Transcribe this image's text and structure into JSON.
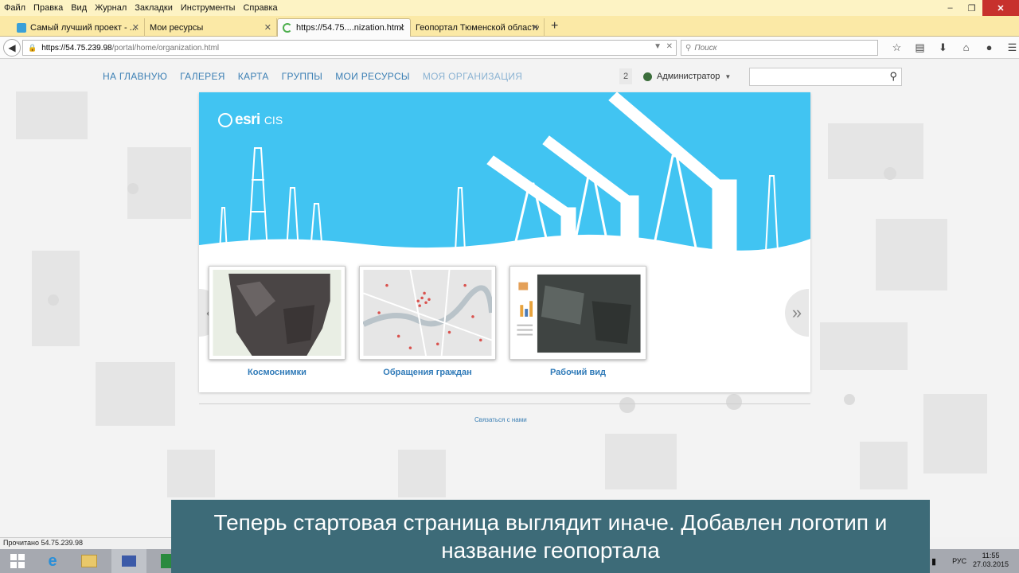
{
  "menubar": {
    "items": [
      "Файл",
      "Правка",
      "Вид",
      "Журнал",
      "Закладки",
      "Инструменты",
      "Справка"
    ]
  },
  "window_controls": {
    "minimize": "–",
    "maximize": "❐",
    "close": "✕"
  },
  "tabs": [
    {
      "label": "Самый лучший проект - ...",
      "favicon_color": "#3aa0d8"
    },
    {
      "label": "Мои ресурсы",
      "favicon_color": ""
    },
    {
      "label": "https://54.75....nization.html",
      "favicon_color": "#4cae4c"
    },
    {
      "label": "Геопортал Тюменской области",
      "favicon_color": ""
    }
  ],
  "url": {
    "host": "https://54.75.239.98",
    "path": "/portal/home/organization.html"
  },
  "search_placeholder": "Поиск",
  "portal": {
    "nav": [
      "НА ГЛАВНУЮ",
      "ГАЛЕРЕЯ",
      "КАРТА",
      "ГРУППЫ",
      "МОИ РЕСУРСЫ",
      "МОЯ ОРГАНИЗАЦИЯ"
    ],
    "notification_count": "2",
    "user": "Администратор",
    "logo": {
      "brand": "esri",
      "suffix": "CIS"
    },
    "carousel": [
      {
        "label": "Космоснимки"
      },
      {
        "label": "Обращения граждан"
      },
      {
        "label": "Рабочий вид"
      }
    ],
    "arrow_prev": "«",
    "arrow_next": "»",
    "footer_link": "Связаться с нами"
  },
  "status_text": "Прочитано 54.75.239.98",
  "taskbar": {
    "language": "РУС",
    "time": "11:55",
    "date": "27.03.2015"
  },
  "caption": "Теперь стартовая страница выглядит иначе. Добавлен логотип и название геопортала",
  "colors": {
    "banner": "#41c4f2",
    "caption": "#3d6b78",
    "link": "#3b7fb4",
    "menubar": "#fdf3c4"
  }
}
